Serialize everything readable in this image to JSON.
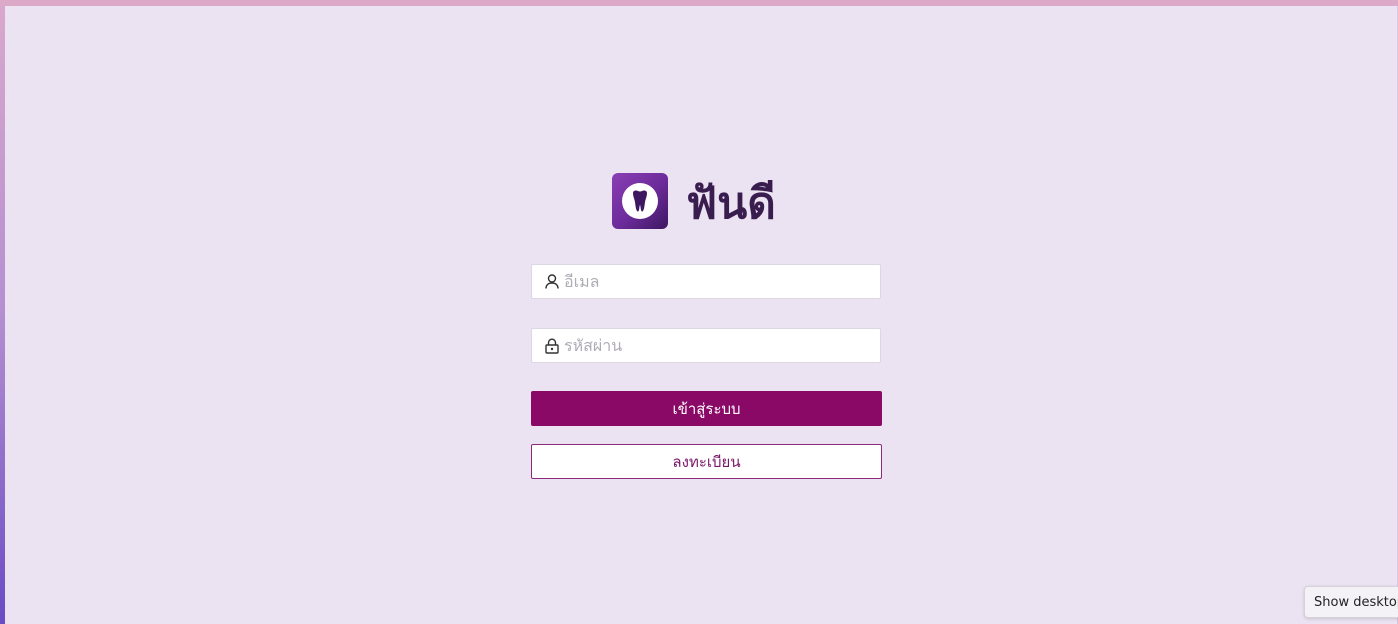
{
  "app": {
    "name": "ฟันดี",
    "brand_color": "#6b2a99",
    "logo_icon": "tooth-icon"
  },
  "login_form": {
    "email": {
      "placeholder": "อีเมล",
      "value": "",
      "icon": "user-icon"
    },
    "password": {
      "placeholder": "รหัสผ่าน",
      "value": "",
      "icon": "lock-icon"
    },
    "login_button_label": "เข้าสู่ระบบ",
    "register_button_label": "ลงทะเบียน",
    "primary_color": "#8a0866"
  },
  "taskbar": {
    "show_desktop_tooltip": "Show desktop"
  }
}
